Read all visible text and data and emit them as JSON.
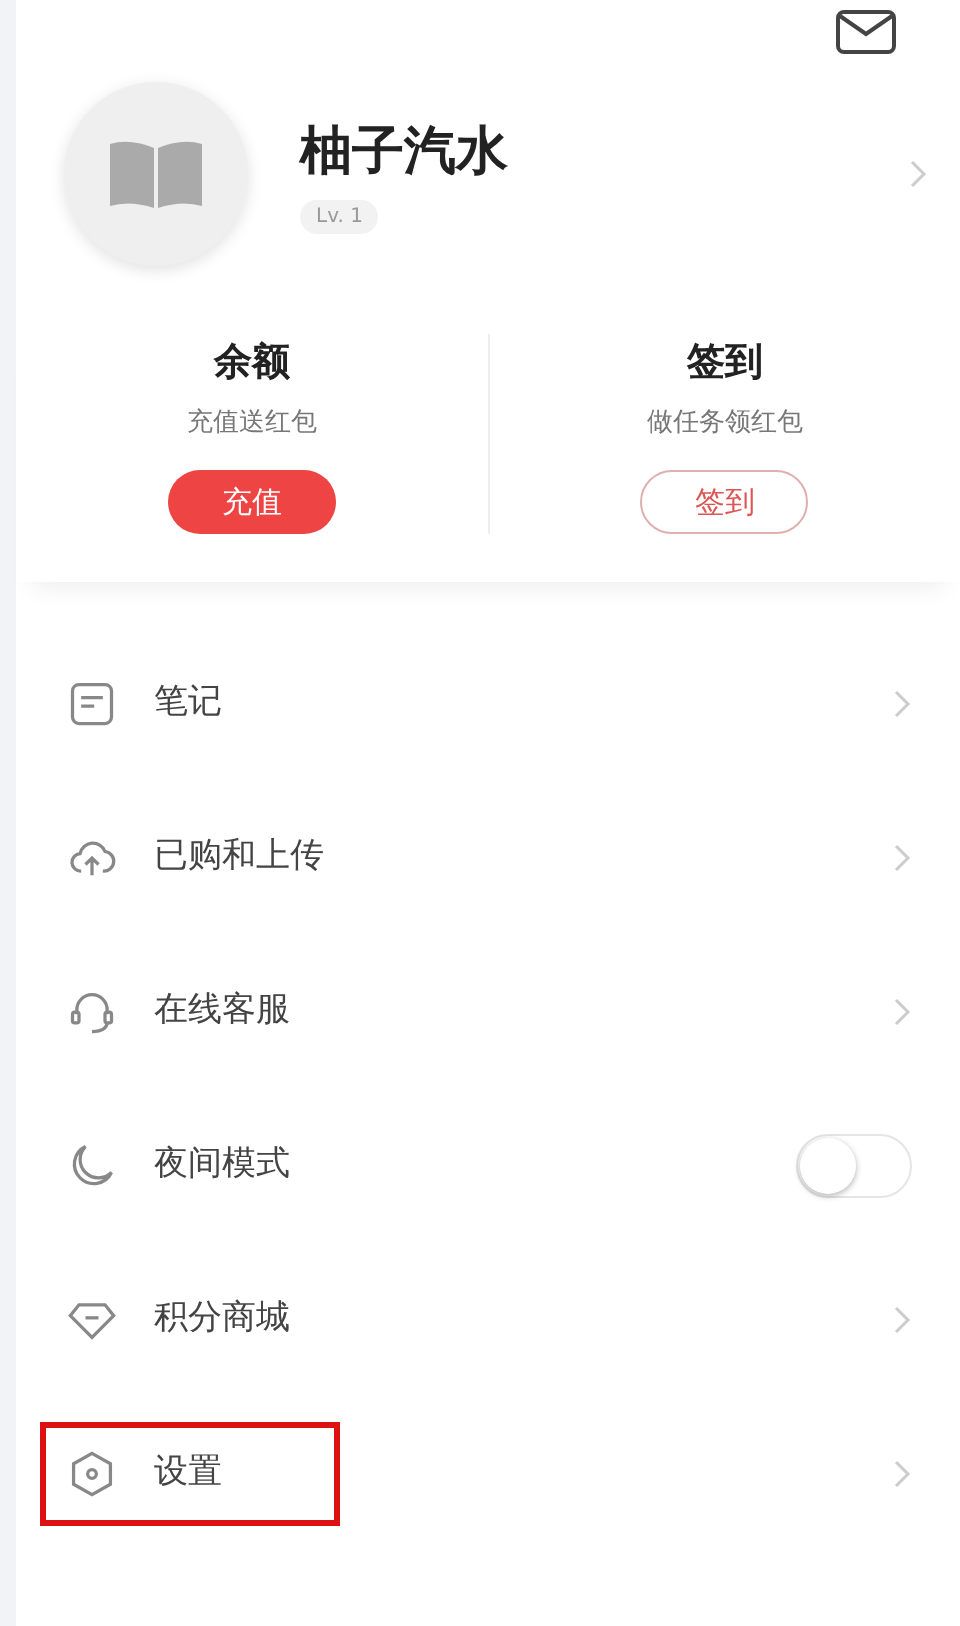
{
  "profile": {
    "name": "柚子汽水",
    "level_badge": "Lv. 1"
  },
  "stats": [
    {
      "title": "余额",
      "subtitle": "充值送红包",
      "button": "充值",
      "kind": "filled"
    },
    {
      "title": "签到",
      "subtitle": "做任务领红包",
      "button": "签到",
      "kind": "outline"
    }
  ],
  "menu": [
    {
      "label": "笔记",
      "kind": "link",
      "highlighted": false
    },
    {
      "label": "已购和上传",
      "kind": "link",
      "highlighted": false
    },
    {
      "label": "在线客服",
      "kind": "link",
      "highlighted": false
    },
    {
      "label": "夜间模式",
      "kind": "toggle",
      "on": false,
      "highlighted": false
    },
    {
      "label": "积分商城",
      "kind": "link",
      "highlighted": false
    },
    {
      "label": "设置",
      "kind": "link",
      "highlighted": true
    }
  ]
}
